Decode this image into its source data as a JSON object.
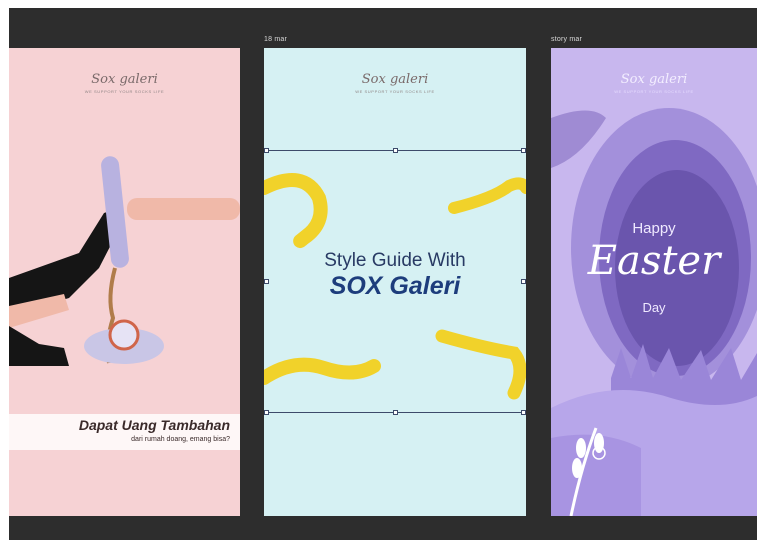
{
  "artboards": [
    {
      "label": "",
      "brand": {
        "name": "Sox galeri",
        "tagline": "WE SUPPORT YOUR SOCKS LIFE"
      },
      "headline": "Dapat Uang Tambahan",
      "subline": "dari rumah doang, emang bisa?",
      "background": "#f6d2d4"
    },
    {
      "label": "18 mar",
      "brand": {
        "name": "Sox galeri",
        "tagline": "WE SUPPORT YOUR SOCKS LIFE"
      },
      "line1": "Style Guide With",
      "line2": "SOX Galeri",
      "background": "#d6f1f3",
      "selection_color": "#3d4b6a"
    },
    {
      "label": "story mar",
      "brand": {
        "name": "Sox galeri",
        "tagline": "WE SUPPORT YOUR SOCKS LIFE"
      },
      "line1": "Happy",
      "line2": "Easter",
      "line3": "Day",
      "background": "#c8b7ee"
    }
  ],
  "canvas": {
    "background": "#2d2d2d"
  }
}
